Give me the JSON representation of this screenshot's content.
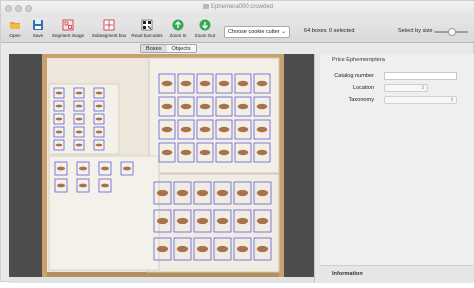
{
  "window": {
    "title": "Ephemera000.crowded"
  },
  "toolbar": {
    "open": "Open",
    "save": "Save",
    "segment_image": "Segment image",
    "subsegment_box": "Subsegment box",
    "read_barcodes": "Read barcodes",
    "zoom_in": "Zoom In",
    "zoom_out": "Zoom Out",
    "cookie_cutter": "Choose cookie cutter",
    "boxes_count": "64 boxes",
    "selected_count": "0 selected",
    "select_by_size": "Select by size"
  },
  "tabs": {
    "boxes": "Boxes",
    "objects": "Objects",
    "active": "Boxes"
  },
  "panel": {
    "header": "Price Ephemeroptera",
    "catalog_number_label": "Catalog number",
    "catalog_number_value": "",
    "location_label": "Location",
    "taxonomy_label": "Taxonomy",
    "information_label": "Information"
  },
  "colors": {
    "accent": "#4c4ccf",
    "drawer_wood": "#c9a070",
    "canvas": "#4d4d4d"
  },
  "slider": {
    "value": 0.42
  }
}
